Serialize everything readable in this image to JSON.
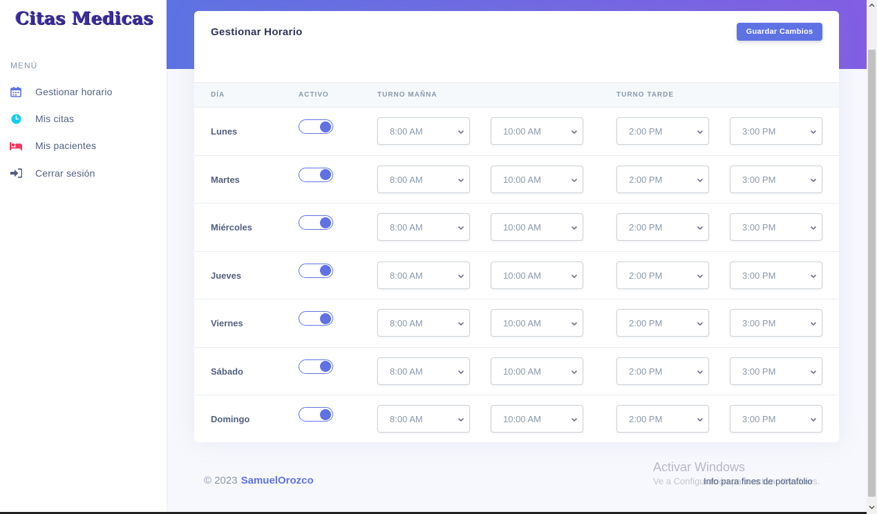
{
  "brand": {
    "title": "Citas Medicas"
  },
  "sidebar": {
    "heading": "MENÚ",
    "items": [
      {
        "label": "Gestionar horario",
        "icon": "calendar-icon",
        "color": "#5e72e4"
      },
      {
        "label": "Mis citas",
        "icon": "clock-icon",
        "color": "#11cdef"
      },
      {
        "label": "Mis pacientes",
        "icon": "bed-icon",
        "color": "#f5365c"
      },
      {
        "label": "Cerrar sesión",
        "icon": "sign-in-icon",
        "color": "#525f7f"
      }
    ]
  },
  "card": {
    "title": "Gestionar Horario",
    "save_label": "Guardar Cambios"
  },
  "table": {
    "headers": {
      "day": "DÍA",
      "active": "ACTIVO",
      "morning": "TURNO MAÑNA",
      "afternoon": "TURNO TARDE"
    },
    "rows": [
      {
        "day": "Lunes",
        "active": true,
        "morning_start": "8:00 AM",
        "morning_end": "10:00 AM",
        "afternoon_start": "2:00 PM",
        "afternoon_end": "3:00 PM"
      },
      {
        "day": "Martes",
        "active": true,
        "morning_start": "8:00 AM",
        "morning_end": "10:00 AM",
        "afternoon_start": "2:00 PM",
        "afternoon_end": "3:00 PM"
      },
      {
        "day": "Miércoles",
        "active": true,
        "morning_start": "8:00 AM",
        "morning_end": "10:00 AM",
        "afternoon_start": "2:00 PM",
        "afternoon_end": "3:00 PM"
      },
      {
        "day": "Jueves",
        "active": true,
        "morning_start": "8:00 AM",
        "morning_end": "10:00 AM",
        "afternoon_start": "2:00 PM",
        "afternoon_end": "3:00 PM"
      },
      {
        "day": "Viernes",
        "active": true,
        "morning_start": "8:00 AM",
        "morning_end": "10:00 AM",
        "afternoon_start": "2:00 PM",
        "afternoon_end": "3:00 PM"
      },
      {
        "day": "Sábado",
        "active": true,
        "morning_start": "8:00 AM",
        "morning_end": "10:00 AM",
        "afternoon_start": "2:00 PM",
        "afternoon_end": "3:00 PM"
      },
      {
        "day": "Domingo",
        "active": true,
        "morning_start": "8:00 AM",
        "morning_end": "10:00 AM",
        "afternoon_start": "2:00 PM",
        "afternoon_end": "3:00 PM"
      }
    ]
  },
  "footer": {
    "copyright": "© 2023",
    "author": "SamuelOrozco",
    "note": "Info para fines de portafolio"
  },
  "windows_watermark": {
    "title": "Activar Windows",
    "subtitle": "Ve a Configuración para activar Windows."
  },
  "colors": {
    "primary": "#5e72e4",
    "gradient_end": "#825ee4"
  }
}
